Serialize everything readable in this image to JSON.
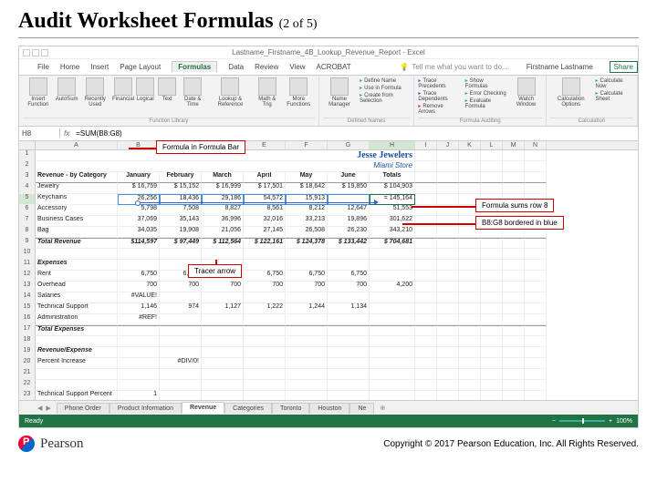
{
  "slide": {
    "title": "Audit Worksheet Formulas",
    "subtitle": "(2 of 5)"
  },
  "excel": {
    "app_title": "Lastname_Firstname_4B_Lookup_Revenue_Report - Excel",
    "user": "Firstname Lastname",
    "share": "Share",
    "tabs": [
      "File",
      "Home",
      "Insert",
      "Page Layout",
      "Formulas",
      "Data",
      "Review",
      "View",
      "ACROBAT"
    ],
    "active_tab": "Formulas",
    "tellme": "Tell me what you want to do...",
    "ribbon": {
      "group_func_lib": "Function Library",
      "group_names": "Defined Names",
      "group_audit": "Formula Auditing",
      "group_calc": "Calculation",
      "insert_function": "Insert Function",
      "autosum": "AutoSum",
      "recently": "Recently Used",
      "financial": "Financial",
      "logical": "Logical",
      "text": "Text",
      "datetime": "Date & Time",
      "lookup": "Lookup & Reference",
      "math": "Math & Trig",
      "more": "More Functions",
      "name_mgr": "Name Manager",
      "define_name": "Define Name",
      "use_formula": "Use in Formula",
      "create_sel": "Create from Selection",
      "trace_prec": "Trace Precedents",
      "trace_dep": "Trace Dependents",
      "remove_arr": "Remove Arrows",
      "show_form": "Show Formulas",
      "err_check": "Error Checking",
      "eval_form": "Evaluate Formula",
      "watch": "Watch Window",
      "calc_opts": "Calculation Options",
      "calc_now": "Calculate Now",
      "calc_sheet": "Calculate Sheet"
    },
    "namebox": "H8",
    "formula": "=SUM(B8:G8)",
    "columns": [
      "A",
      "B",
      "C",
      "D",
      "E",
      "F",
      "G",
      "H",
      "I",
      "J",
      "K",
      "L",
      "M",
      "N"
    ],
    "sheet": {
      "title": "Jesse Jewelers",
      "subtitle": "Miami Store",
      "headers": [
        "Revenue - by Category",
        "January",
        "February",
        "March",
        "April",
        "May",
        "June",
        "Totals"
      ],
      "rows": [
        {
          "label": "Jewelry",
          "vals": [
            "$ 16,759",
            "$ 15,152",
            "$ 16,999",
            "$ 17,501",
            "$ 18,642",
            "$ 19,850",
            "$ 104,903"
          ]
        },
        {
          "label": "Keychains",
          "vals": [
            "26,256",
            "18,436",
            "29,186",
            "54,572",
            "15,913",
            "",
            "= 145,164"
          ],
          "blue": true,
          "active": true
        },
        {
          "label": "Accessory",
          "vals": [
            "5,798",
            "7,508",
            "8,827",
            "8,561",
            "8,212",
            "12,647",
            "51,553"
          ]
        },
        {
          "label": "Business Cases",
          "vals": [
            "37,069",
            "35,143",
            "36,996",
            "32,016",
            "33,213",
            "19,896",
            "301,622"
          ]
        },
        {
          "label": "Bag",
          "vals": [
            "34,035",
            "19,908",
            "21,056",
            "27,145",
            "26,508",
            "26,230",
            "343,210"
          ]
        }
      ],
      "total_rev": {
        "label": "Total Revenue",
        "vals": [
          "$114,597",
          "$ 97,449",
          "$ 112,564",
          "$ 122,161",
          "$ 124,378",
          "$ 133,442",
          "$ 704,681"
        ]
      },
      "expenses_hdr": "Expenses",
      "exp_rows": [
        {
          "label": "Rent",
          "vals": [
            "6,750",
            "6,750",
            "6,750",
            "6,750",
            "6,750",
            "6,750",
            ""
          ]
        },
        {
          "label": "Overhead",
          "vals": [
            "700",
            "700",
            "700",
            "700",
            "700",
            "700",
            "4,200"
          ]
        },
        {
          "label": "Salaries",
          "vals": [
            "#VALUE!",
            "",
            "",
            "",
            "",
            "",
            ""
          ]
        },
        {
          "label": "Technical Support",
          "vals": [
            "1,146",
            "974",
            "1,127",
            "1,222",
            "1,244",
            "1,134",
            ""
          ]
        },
        {
          "label": "Administration",
          "vals": [
            "#REF!",
            "",
            "",
            "",
            "",
            "",
            ""
          ]
        }
      ],
      "total_exp": {
        "label": "Total Expenses",
        "vals": [
          "",
          "",
          "",
          "",
          "",
          "",
          ""
        ]
      },
      "re": {
        "label": "Revenue/Expense"
      },
      "pi": {
        "label": "Percent Increase",
        "vals": [
          "",
          "#DIV/0!",
          "",
          "",
          "",
          "",
          ""
        ]
      },
      "ts": {
        "label": "Technical Support Percent",
        "vals": [
          "1",
          "",
          "",
          "",
          "",
          "",
          ""
        ]
      }
    },
    "sheet_tabs": [
      "Phone Order",
      "Product Information",
      "Revenue",
      "Categories",
      "Toronto",
      "Houston",
      "Ne"
    ],
    "active_sheet": "Revenue",
    "status": "Ready",
    "zoom": "100%"
  },
  "callouts": {
    "formula_bar": "Formula in Formula Bar",
    "sums_row": "Formula sums row 8",
    "bordered": "B8:G8 bordered in blue",
    "tracer": "Tracer arrow"
  },
  "footer": {
    "brand": "Pearson",
    "copyright": "Copyright © 2017 Pearson Education, Inc. All Rights Reserved."
  }
}
